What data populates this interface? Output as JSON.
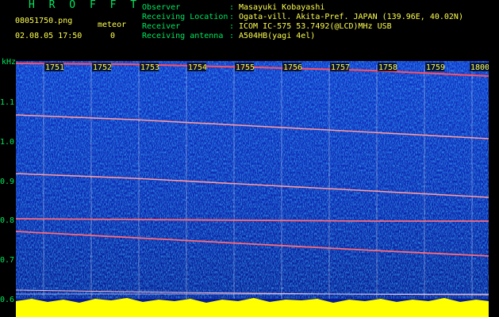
{
  "header": {
    "app_title": "H R O F F T",
    "filename": "08051750.png",
    "datetime": "02.08.05 17:50",
    "meteor_label": "meteor",
    "meteor_count": "0"
  },
  "info": [
    {
      "label": "Observer",
      "value": "Masayuki Kobayashi"
    },
    {
      "label": "Receiving Location",
      "value": "Ogata-vill. Akita-Pref. JAPAN (139.96E, 40.02N)"
    },
    {
      "label": "Receiver",
      "value": "ICOM IC-575 53.7492(@LCD)MHz USB"
    },
    {
      "label": "Receiving antenna",
      "value": "A504HB(yagi 4el)"
    }
  ],
  "axis": {
    "unit": "kHz",
    "y_ticks": [
      "1.1",
      "1.0",
      "0.9",
      "0.8",
      "0.7",
      "0.6"
    ],
    "time_labels": [
      "1751",
      "1752",
      "1753",
      "1754",
      "1755",
      "1756",
      "1757",
      "1758",
      "1759",
      "1800"
    ]
  },
  "colors": {
    "label_green": "#00e860",
    "value_yellow": "#ffff50",
    "background": "#000000",
    "spectrogram_base": "#0a1aa0"
  }
}
